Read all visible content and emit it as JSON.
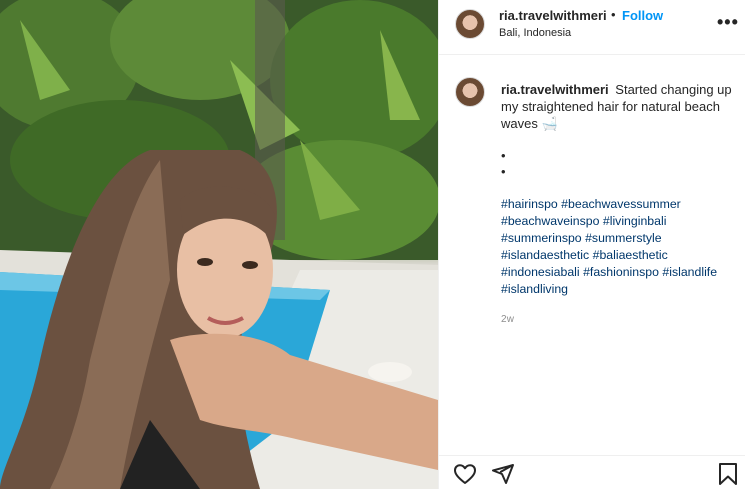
{
  "post": {
    "username": "ria.travelwithmeri",
    "separator": "•",
    "follow_label": "Follow",
    "location": "Bali, Indonesia",
    "more_label": "•••",
    "caption": {
      "username": "ria.travelwithmeri",
      "text": "Started changing up my straightened hair for natural beach waves 🛁",
      "dots": [
        "•",
        "•"
      ],
      "hashtags": [
        "#hairinspo",
        "#beachwavessummer",
        "#beachwaveinspo",
        "#livinginbali",
        "#summerinspo",
        "#summerstyle",
        "#islandaesthetic",
        "#baliaesthetic",
        "#indonesiabali",
        "#fashioninspo",
        "#islandlife",
        "#islandliving"
      ],
      "timestamp": "2w"
    }
  },
  "actions": {
    "like_icon": "heart-icon",
    "share_icon": "send-icon",
    "save_icon": "bookmark-icon"
  },
  "colors": {
    "link_blue": "#0095f6",
    "hashtag": "#00376b",
    "muted": "#8e8e8e",
    "pool": "#2aa7d8"
  }
}
